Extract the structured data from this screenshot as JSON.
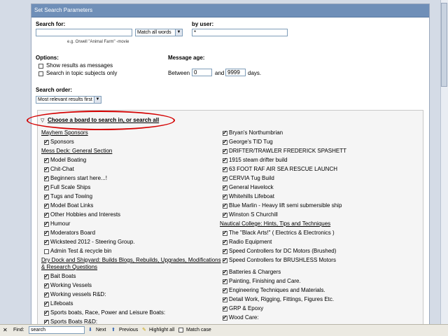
{
  "panel": {
    "title": "Set Search Parameters"
  },
  "search_for": {
    "label": "Search for:",
    "value": "",
    "mode": "Match all words",
    "hint": "e.g. Orwell \"Animal Farm\" -movie"
  },
  "by_user": {
    "label": "by user:",
    "value": "*"
  },
  "options": {
    "label": "Options:",
    "show_messages": "Show results as messages",
    "topic_subjects": "Search in topic subjects only"
  },
  "message_age": {
    "label": "Message age:",
    "between": "Between",
    "from": "0",
    "and": "and",
    "to": "9999",
    "days": "days."
  },
  "search_order": {
    "label": "Search order:",
    "value": "Most relevant results first"
  },
  "boards_toggle": "Choose a board to search in, or search all",
  "left_column": [
    {
      "type": "group",
      "label": "Mayhem Sponsors"
    },
    {
      "type": "board",
      "label": "Sponsors",
      "checked": true
    },
    {
      "type": "group",
      "label": "Mess Deck: General Section"
    },
    {
      "type": "board",
      "label": "Model Boating",
      "checked": true
    },
    {
      "type": "board",
      "label": "Chit-Chat",
      "checked": true
    },
    {
      "type": "board",
      "label": "Beginners start here...!",
      "checked": true
    },
    {
      "type": "board",
      "label": "Full Scale Ships",
      "checked": true
    },
    {
      "type": "board",
      "label": "Tugs and Towing",
      "checked": true
    },
    {
      "type": "board",
      "label": "Model Boat Links",
      "checked": true
    },
    {
      "type": "board",
      "label": "Other Hobbies and Interests",
      "checked": true
    },
    {
      "type": "board",
      "label": "Humour",
      "checked": true
    },
    {
      "type": "board",
      "label": "Moderators Board",
      "checked": true
    },
    {
      "type": "board",
      "label": "Wicksteed 2012 - Steering Group.",
      "checked": true
    },
    {
      "type": "board",
      "label": "Admin Test & recycle bin",
      "checked": false
    },
    {
      "type": "group2",
      "label": "Dry Dock and Shipyard: Builds Blogs, Rebuilds, Upgrades, Modifications",
      "label2": "& Research Questions"
    },
    {
      "type": "board",
      "label": "Bait Boats",
      "checked": true
    },
    {
      "type": "board",
      "label": "Working Vessels",
      "checked": true
    },
    {
      "type": "board",
      "label": "Working vessels R&D:",
      "checked": true
    },
    {
      "type": "board",
      "label": "Lifeboats",
      "checked": true
    },
    {
      "type": "board",
      "label": "Sports boats, Race, Power and Leisure Boats:",
      "checked": true
    },
    {
      "type": "board",
      "label": "Sports Boats R&D:",
      "checked": true
    }
  ],
  "right_column": [
    {
      "type": "board",
      "label": "Bryan's Northumbrian",
      "checked": true
    },
    {
      "type": "board",
      "label": "George's TID Tug",
      "checked": true
    },
    {
      "type": "board",
      "label": "DRIFTER/TRAWLER FREDERICK SPASHETT",
      "checked": true
    },
    {
      "type": "board",
      "label": "1915 steam drifter build",
      "checked": true
    },
    {
      "type": "board",
      "label": "63 FOOT RAF AIR SEA RESCUE LAUNCH",
      "checked": true
    },
    {
      "type": "board",
      "label": "CERVIA Tug Build",
      "checked": true
    },
    {
      "type": "board",
      "label": "General Havelock",
      "checked": true
    },
    {
      "type": "board",
      "label": "Whitehills Lifeboat",
      "checked": true
    },
    {
      "type": "board",
      "label": "Blue Marlin - Heavy lift semi submersible ship",
      "checked": true
    },
    {
      "type": "board",
      "label": "Winston S Churchill",
      "checked": true
    },
    {
      "type": "group",
      "label": "Nautical College: Hints, Tips and Techniques"
    },
    {
      "type": "board",
      "label": "The \"Black Arts!\" ( Electrics & Electronics )",
      "checked": true
    },
    {
      "type": "board",
      "label": "Radio Equipment",
      "checked": true
    },
    {
      "type": "board",
      "label": "Speed Controllers for DC Motors (Brushed)",
      "checked": true
    },
    {
      "type": "board2",
      "label": "Speed Controllers for BRUSHLESS Motors",
      "checked": true
    },
    {
      "type": "board",
      "label": "Batteries & Chargers",
      "checked": true
    },
    {
      "type": "board",
      "label": "Painting, Finishing and Care.",
      "checked": true
    },
    {
      "type": "board",
      "label": "Engineering Techniques and Materials.",
      "checked": true
    },
    {
      "type": "board",
      "label": "Detail Work, Rigging, Fittings, Figures Etc.",
      "checked": true
    },
    {
      "type": "board",
      "label": "GRP & Epoxy",
      "checked": true
    },
    {
      "type": "board",
      "label": "Wood Care:",
      "checked": true
    }
  ],
  "findbar": {
    "find_label": "Find:",
    "query": "search",
    "next": "Next",
    "previous": "Previous",
    "highlight": "Highlight all",
    "match_case": "Match case",
    "colors": {
      "accent": "#6f8fb8",
      "highlight_ring": "#d40000"
    }
  }
}
